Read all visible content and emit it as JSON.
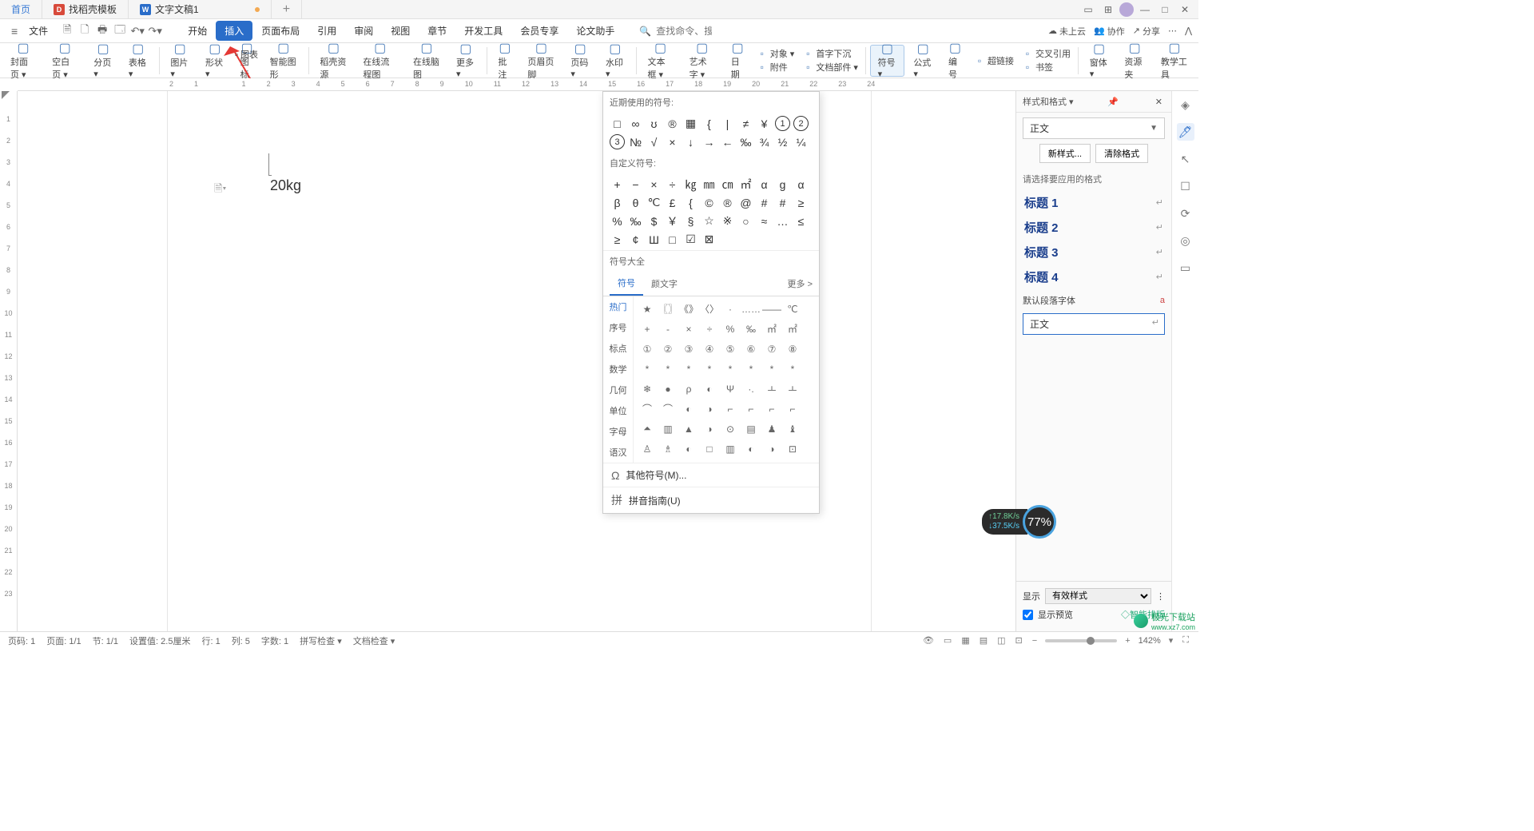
{
  "tabs": {
    "home": "首页",
    "templates": "找稻壳模板",
    "doc": "文字文稿1"
  },
  "menubar": {
    "file": "文件",
    "items": [
      "开始",
      "插入",
      "页面布局",
      "引用",
      "审阅",
      "视图",
      "章节",
      "开发工具",
      "会员专享",
      "论文助手"
    ],
    "active": "插入",
    "search_ic_ph": "查找命令、搜索模板"
  },
  "topright": {
    "cloud": "未上云",
    "collab": "协作",
    "share": "分享"
  },
  "ribbon": {
    "r": [
      {
        "n": "封面页",
        "d": 1
      },
      {
        "n": "空白页",
        "d": 1
      },
      {
        "n": "分页",
        "d": 1
      },
      {
        "n": "表格",
        "d": 1
      },
      {
        "n": "图片",
        "d": 1
      },
      {
        "n": "形状",
        "d": 1
      },
      {
        "n": "图标",
        "d": 0
      },
      {
        "n": "智能图形",
        "d": 0
      },
      {
        "n": "稻壳资源",
        "d": 0
      },
      {
        "n": "在线流程图",
        "d": 0
      },
      {
        "n": "在线脑图",
        "d": 0
      },
      {
        "n": "更多",
        "d": 1
      },
      {
        "n": "批注",
        "d": 0
      },
      {
        "n": "页眉页脚",
        "d": 0
      },
      {
        "n": "页码",
        "d": 1
      },
      {
        "n": "水印",
        "d": 1
      },
      {
        "n": "文本框",
        "d": 1
      },
      {
        "n": "艺术字",
        "d": 1
      },
      {
        "n": "日期",
        "d": 0
      }
    ],
    "small1": [
      {
        "l": "对象",
        "d": 1
      },
      {
        "l": "附件",
        "d": 0
      }
    ],
    "small2": [
      {
        "l": "首字下沉",
        "d": 0
      },
      {
        "l": "文档部件",
        "d": 1
      }
    ],
    "r2": [
      {
        "n": "符号",
        "d": 1
      },
      {
        "n": "公式",
        "d": 1
      },
      {
        "n": "编号",
        "d": 0
      }
    ],
    "small3": [
      {
        "l": "超链接",
        "d": 0
      }
    ],
    "small4": [
      {
        "l": "交叉引用",
        "d": 0
      },
      {
        "l": "书签",
        "d": 0
      }
    ],
    "r3": [
      {
        "n": "窗体",
        "d": 1
      },
      {
        "n": "资源夹",
        "d": 0
      },
      {
        "n": "教学工具",
        "d": 0
      }
    ],
    "chart_label": "图表",
    "highlight": "符号"
  },
  "doc": {
    "text": "20kg"
  },
  "symbol_panel": {
    "recent_title": "近期使用的符号:",
    "recent": [
      "□",
      "∞",
      "ʊ",
      "®",
      "▦",
      "{",
      "|",
      "≠",
      "¥",
      "①",
      "②",
      "③",
      "№",
      "√",
      "×",
      "↓",
      "→",
      "←",
      "‰",
      "¾",
      "½",
      "¼"
    ],
    "custom_title": "自定义符号:",
    "custom": [
      "+",
      "−",
      "×",
      "÷",
      "㎏",
      "㎜",
      "㎝",
      "㎡",
      "α",
      "g",
      "α",
      "β",
      "θ",
      "℃",
      "£",
      "{",
      "©",
      "®",
      "@",
      "#",
      "#",
      "≥",
      "%",
      "‰",
      "$",
      "￥",
      "§",
      "☆",
      "※",
      "○",
      "≈",
      "…",
      "≤",
      "≥",
      "¢",
      "Ш",
      "□",
      "☑",
      "⊠"
    ],
    "all_title": "符号大全",
    "tabs": [
      "符号",
      "颜文字"
    ],
    "more": "更多 >",
    "cats": [
      "热门",
      "序号",
      "标点",
      "数学",
      "几何",
      "单位",
      "字母",
      "语汉"
    ],
    "grid": [
      "★",
      "〖〗",
      "《》",
      "〈〉",
      "·",
      "……",
      "——",
      "℃",
      "+",
      "-",
      "×",
      "÷",
      "%",
      "‰",
      "㎡",
      "㎡",
      "①",
      "②",
      "③",
      "④",
      "⑤",
      "⑥",
      "⑦",
      "⑧",
      "*",
      "*",
      "*",
      "*",
      "*",
      "*",
      "*",
      "*",
      "❄",
      "●",
      "ρ",
      "◐",
      "Ψ",
      "·.",
      "ㅗ",
      "ㅗ",
      "⌒",
      "⌒",
      "◐",
      "◑",
      "⌐",
      "⌐",
      "⌐",
      "⌐",
      "⏶",
      "▥",
      "▲",
      "◑",
      "⊙",
      "▤",
      "♟",
      "♝",
      "♙",
      "♗",
      "◐",
      "□",
      "▥",
      "◐",
      "◑",
      "⊡"
    ],
    "other_sym": "其他符号(M)...",
    "pinyin": "拼音指南(U)"
  },
  "side": {
    "title": "样式和格式 ▾",
    "current": "正文",
    "new_btn": "新样式...",
    "clear_btn": "清除格式",
    "hint": "请选择要应用的格式",
    "styles": [
      "标题 1",
      "标题 2",
      "标题 3",
      "标题 4"
    ],
    "default_font": "默认段落字体",
    "input": "正文",
    "show": "显示",
    "show_val": "有效样式",
    "preview": "显示预览",
    "smart": "智能排版"
  },
  "status": {
    "l": [
      "页码: 1",
      "页面: 1/1",
      "节: 1/1",
      "设置值: 2.5厘米",
      "行: 1",
      "列: 5",
      "字数: 1",
      "拼写检查 ▾",
      "文档检查 ▾"
    ],
    "zoom": "142%"
  },
  "speed": {
    "up": "17.8K/s",
    "down": "37.5K/s",
    "pct": "77%"
  },
  "watermark": {
    "t1": "极光下载站",
    "t2": "www.xz7.com"
  }
}
